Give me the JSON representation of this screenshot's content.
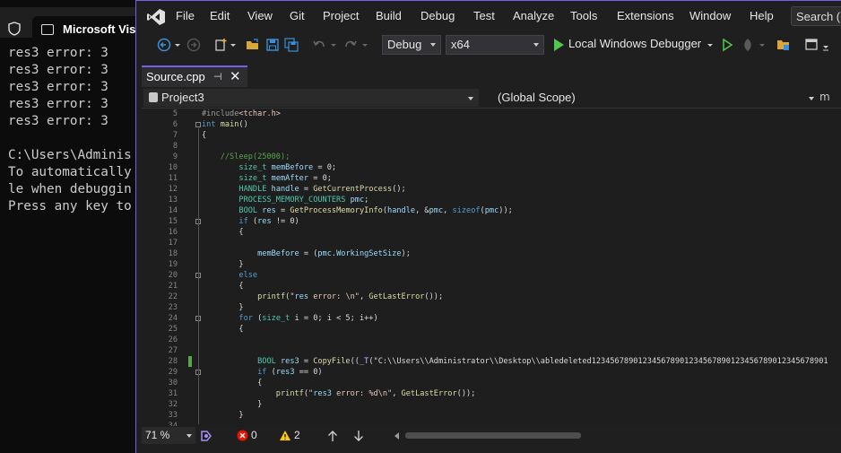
{
  "console": {
    "tab_title": "Microsoft Visu",
    "lines": [
      "res3 error: 3",
      "res3 error: 3",
      "res3 error: 3",
      "res3 error: 3",
      "res3 error: 3",
      "",
      "C:\\Users\\Adminis",
      "To automatically",
      "le when debuggin",
      "Press any key to"
    ]
  },
  "menu": [
    "File",
    "Edit",
    "View",
    "Git",
    "Project",
    "Build",
    "Debug",
    "Test",
    "Analyze",
    "Tools",
    "Extensions",
    "Window",
    "Help"
  ],
  "search_label": "Search (C",
  "toolbar": {
    "config": "Debug",
    "platform": "x64",
    "run_label": "Local Windows Debugger"
  },
  "tab": {
    "label": "Source.cpp",
    "pin": "⊣",
    "close": "✕"
  },
  "navbar": {
    "project": "Project3",
    "scope": "(Global Scope)",
    "member": "m"
  },
  "code_lines": [
    {
      "n": "5",
      "t": "#include<tchar.h>"
    },
    {
      "n": "6",
      "t": "int main()"
    },
    {
      "n": "7",
      "t": "{"
    },
    {
      "n": "8",
      "t": ""
    },
    {
      "n": "9",
      "t": "    //Sleep(25000);"
    },
    {
      "n": "10",
      "t": "        size_t memBefore = 0;"
    },
    {
      "n": "11",
      "t": "        size_t memAfter = 0;"
    },
    {
      "n": "12",
      "t": "        HANDLE handle = GetCurrentProcess();"
    },
    {
      "n": "13",
      "t": "        PROCESS_MEMORY_COUNTERS pmc;"
    },
    {
      "n": "14",
      "t": "        BOOL res = GetProcessMemoryInfo(handle, &pmc, sizeof(pmc));"
    },
    {
      "n": "15",
      "t": "        if (res != 0)"
    },
    {
      "n": "16",
      "t": "        {"
    },
    {
      "n": "17",
      "t": ""
    },
    {
      "n": "18",
      "t": "            memBefore = (pmc.WorkingSetSize);"
    },
    {
      "n": "19",
      "t": "        }"
    },
    {
      "n": "20",
      "t": "        else"
    },
    {
      "n": "21",
      "t": "        {"
    },
    {
      "n": "22",
      "t": "            printf(\"res error: \\n\", GetLastError());"
    },
    {
      "n": "23",
      "t": "        }"
    },
    {
      "n": "24",
      "t": "        for (size_t i = 0; i < 5; i++)"
    },
    {
      "n": "25",
      "t": "        {"
    },
    {
      "n": "26",
      "t": ""
    },
    {
      "n": "27",
      "t": ""
    },
    {
      "n": "28",
      "t": "            BOOL res3 = CopyFile((_T(\"C:\\\\Users\\\\Administrator\\\\Desktop\\\\abledeleted123456789012345678901234567890123456789012345678901"
    },
    {
      "n": "29",
      "t": "            if (res3 == 0)"
    },
    {
      "n": "30",
      "t": "            {"
    },
    {
      "n": "31",
      "t": "                printf(\"res3 error: %d\\n\", GetLastError());"
    },
    {
      "n": "32",
      "t": "            }"
    },
    {
      "n": "33",
      "t": "        }"
    },
    {
      "n": "34",
      "t": ""
    }
  ],
  "status": {
    "zoom": "71 %",
    "errors": "0",
    "warnings": "2"
  },
  "colors": {
    "accent": "#7160e8",
    "run_green": "#4ec94e",
    "error_red": "#e51400",
    "warning_yellow": "#ffcc00"
  }
}
